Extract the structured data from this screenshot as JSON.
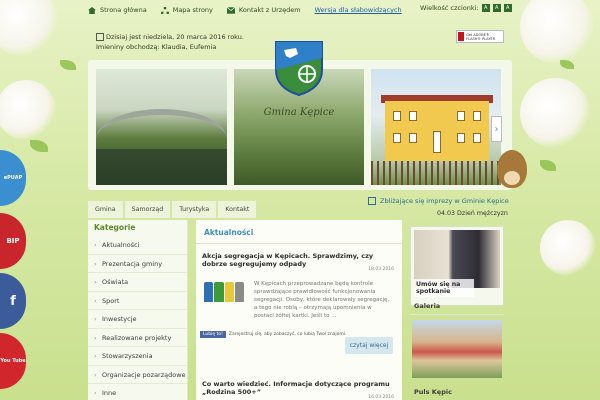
{
  "topbar": {
    "home": "Strona główna",
    "sitemap": "Mapa strony",
    "contact": "Kontakt z Urzędem",
    "wcag": "Wersja dla słabowidzących",
    "fontsize_label": "Wielkość czcionki:",
    "fontsizes": [
      "A",
      "A",
      "A"
    ]
  },
  "date": {
    "line1": "Dzisiaj jest niedziela, 20 marca 2016 roku.",
    "line2": "Imieniny obchodzą: Klaudia, Eufemia"
  },
  "flash": {
    "text": "Get ADOBE® FLASH® PLAYER"
  },
  "slider": {
    "slide2_text": "Gmina Kępice",
    "next_symbol": "›"
  },
  "social": {
    "epuap": "ePUAP",
    "bip": "BIP",
    "fb": "f",
    "yt": "You Tube"
  },
  "nav": {
    "tabs": [
      "Gmina",
      "Samorząd",
      "Turystyka",
      "Kontakt"
    ]
  },
  "events": {
    "heading": "Zbliżające się imprezy w Gminie Kępice",
    "item_date": "04.03",
    "item_title": "Dzień mężczyzn"
  },
  "categories": {
    "heading": "Kategorie",
    "items": [
      "Aktualności",
      "Prezentacja gminy",
      "Oświata",
      "Sport",
      "Inwestycje",
      "Realizowane projekty",
      "Stowarzyszenia",
      "Organizacje pozarządowe",
      "Inne"
    ]
  },
  "main": {
    "heading": "Aktualności",
    "article1": {
      "title": "Akcja segregacja w Kępicach. Sprawdzimy, czy dobrze segregujemy odpady",
      "date": "18.03.2016",
      "body": "W Kępicach przeprowadzane będą kontrole sprawdzające prawidłowość funkcjonowania segregacji. Osoby, które deklarowały segregację, a tego nie robią – otrzymają upomnienia w postaci żółtej kartki. Jeśli to ..."
    },
    "fb_like": "Lubię to!",
    "fb_text": "Zarejestruj się, aby zobaczyć, co lubią Twoi znajomi.",
    "readmore": "czytaj więcej",
    "article2": {
      "title": "Co warto wiedzieć. Informacje dotyczące programu „Rodzina 500+”",
      "date": "16.03.2016"
    }
  },
  "right": {
    "photo_caption": "Umów się na spotkanie",
    "gallery_heading": "Galeria",
    "puls_heading": "Puls Kępic"
  },
  "colors": {
    "accent_green": "#5c8a2a",
    "heading_blue": "#3f8fb8",
    "bin_blue": "#2f6fb4",
    "bin_green": "#3c9a3a",
    "bin_yellow": "#e6c83a",
    "bin_gray": "#8a8a8a"
  }
}
